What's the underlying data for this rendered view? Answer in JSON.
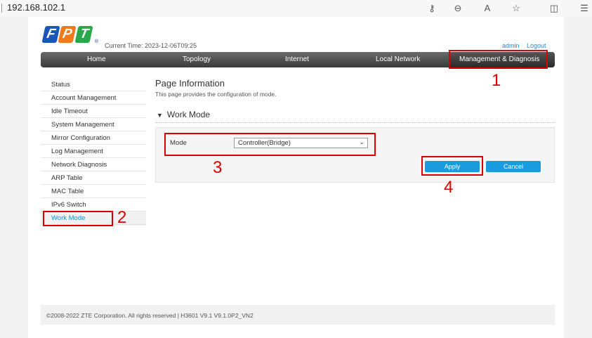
{
  "browser": {
    "url": "192.168.102.1",
    "icons": [
      "key-icon",
      "zoom-out-icon",
      "read-aloud-icon",
      "favorite-star-icon",
      "split-screen-icon",
      "favorites-list-icon"
    ]
  },
  "header": {
    "logo_letters": [
      "F",
      "P",
      "T"
    ],
    "logo_registered": "®",
    "current_time": "Current Time: 2023-12-06T09:25",
    "admin": "admin",
    "logout": "Logout"
  },
  "nav": {
    "items": [
      "Home",
      "Topology",
      "Internet",
      "Local Network",
      "Management & Diagnosis"
    ]
  },
  "sidebar": {
    "items": [
      "Status",
      "Account Management",
      "Idle Timeout",
      "System Management",
      "Mirror Configuration",
      "Log Management",
      "Network Diagnosis",
      "ARP Table",
      "MAC Table",
      "IPv6 Switch",
      "Work Mode"
    ],
    "active": "Work Mode"
  },
  "main": {
    "title": "Page Information",
    "description": "This page provides the configuration of mode.",
    "section": "Work Mode",
    "mode_label": "Mode",
    "mode_value": "Controller(Bridge)",
    "apply_label": "Apply",
    "cancel_label": "Cancel"
  },
  "footer": {
    "text": "©2008-2022 ZTE Corporation. All rights reserved  |   H3601 V9.1 V9.1.0P2_VN2"
  },
  "annotations": [
    "1",
    "2",
    "3",
    "4"
  ],
  "colors": {
    "accent": "#1a9be0",
    "annotation": "#d90000",
    "logo_blue": "#1a56b8",
    "logo_orange": "#f07a1a",
    "logo_green": "#2aa84a"
  }
}
